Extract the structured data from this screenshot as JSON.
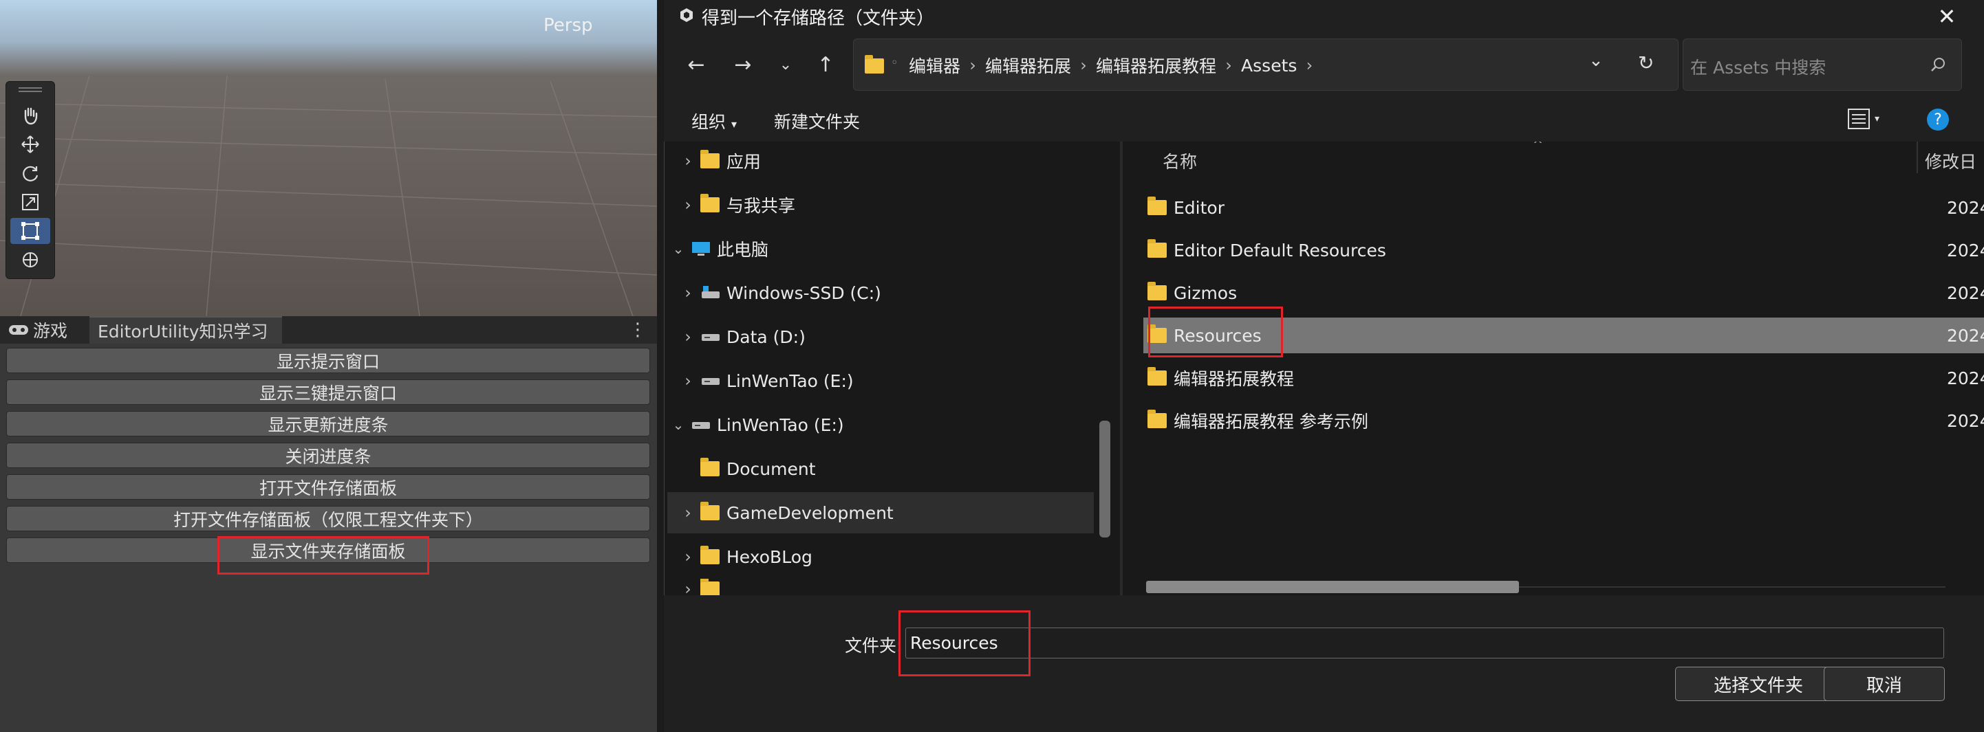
{
  "unity": {
    "scene": {
      "persp_label": "Persp"
    },
    "tabs": {
      "game_label": "游戏",
      "utility_label": "EditorUtility知识学习"
    },
    "buttons": [
      "显示提示窗口",
      "显示三键提示窗口",
      "显示更新进度条",
      "关闭进度条",
      "打开文件存储面板",
      "打开文件存储面板（仅限工程文件夹下）",
      "显示文件夹存储面板"
    ],
    "highlighted_button": "显示文件夹存储面板"
  },
  "dialog": {
    "title": "得到一个存储路径（文件夹）",
    "breadcrumb": [
      "编辑器",
      "编辑器拓展",
      "编辑器拓展教程",
      "Assets"
    ],
    "search_placeholder": "在 Assets 中搜索",
    "commands": {
      "organize": "组织",
      "new_folder": "新建文件夹"
    },
    "nav_items": [
      {
        "label": "应用",
        "type": "folder",
        "expand": ">"
      },
      {
        "label": "与我共享",
        "type": "folder",
        "expand": ">"
      },
      {
        "label": "此电脑",
        "type": "pc",
        "expand": "v"
      },
      {
        "label": "Windows-SSD (C:)",
        "type": "drive",
        "expand": ">"
      },
      {
        "label": "Data (D:)",
        "type": "drive",
        "expand": ">"
      },
      {
        "label": "LinWenTao (E:)",
        "type": "drive",
        "expand": ">"
      },
      {
        "label": "LinWenTao (E:)",
        "type": "drive",
        "expand": "v"
      },
      {
        "label": "Document",
        "type": "folder",
        "expand": ""
      },
      {
        "label": "GameDevelopment",
        "type": "folder",
        "expand": ">"
      },
      {
        "label": "HexoBLog",
        "type": "folder",
        "expand": ">"
      }
    ],
    "columns": {
      "name": "名称",
      "modified": "修改日"
    },
    "files": [
      {
        "name": "Editor",
        "date": "2024/"
      },
      {
        "name": "Editor Default Resources",
        "date": "2024/"
      },
      {
        "name": "Gizmos",
        "date": "2024/"
      },
      {
        "name": "Resources",
        "date": "2024/"
      },
      {
        "name": "编辑器拓展教程",
        "date": "2024/"
      },
      {
        "name": "编辑器拓展教程 参考示例",
        "date": "2024/"
      }
    ],
    "folder_label": "文件夹:",
    "folder_value": "Resources",
    "select_button": "选择文件夹",
    "cancel_button": "取消"
  },
  "colors": {
    "accent": "#3d5d8f",
    "highlight_red": "#e0242c",
    "folder": "#f4c542"
  }
}
